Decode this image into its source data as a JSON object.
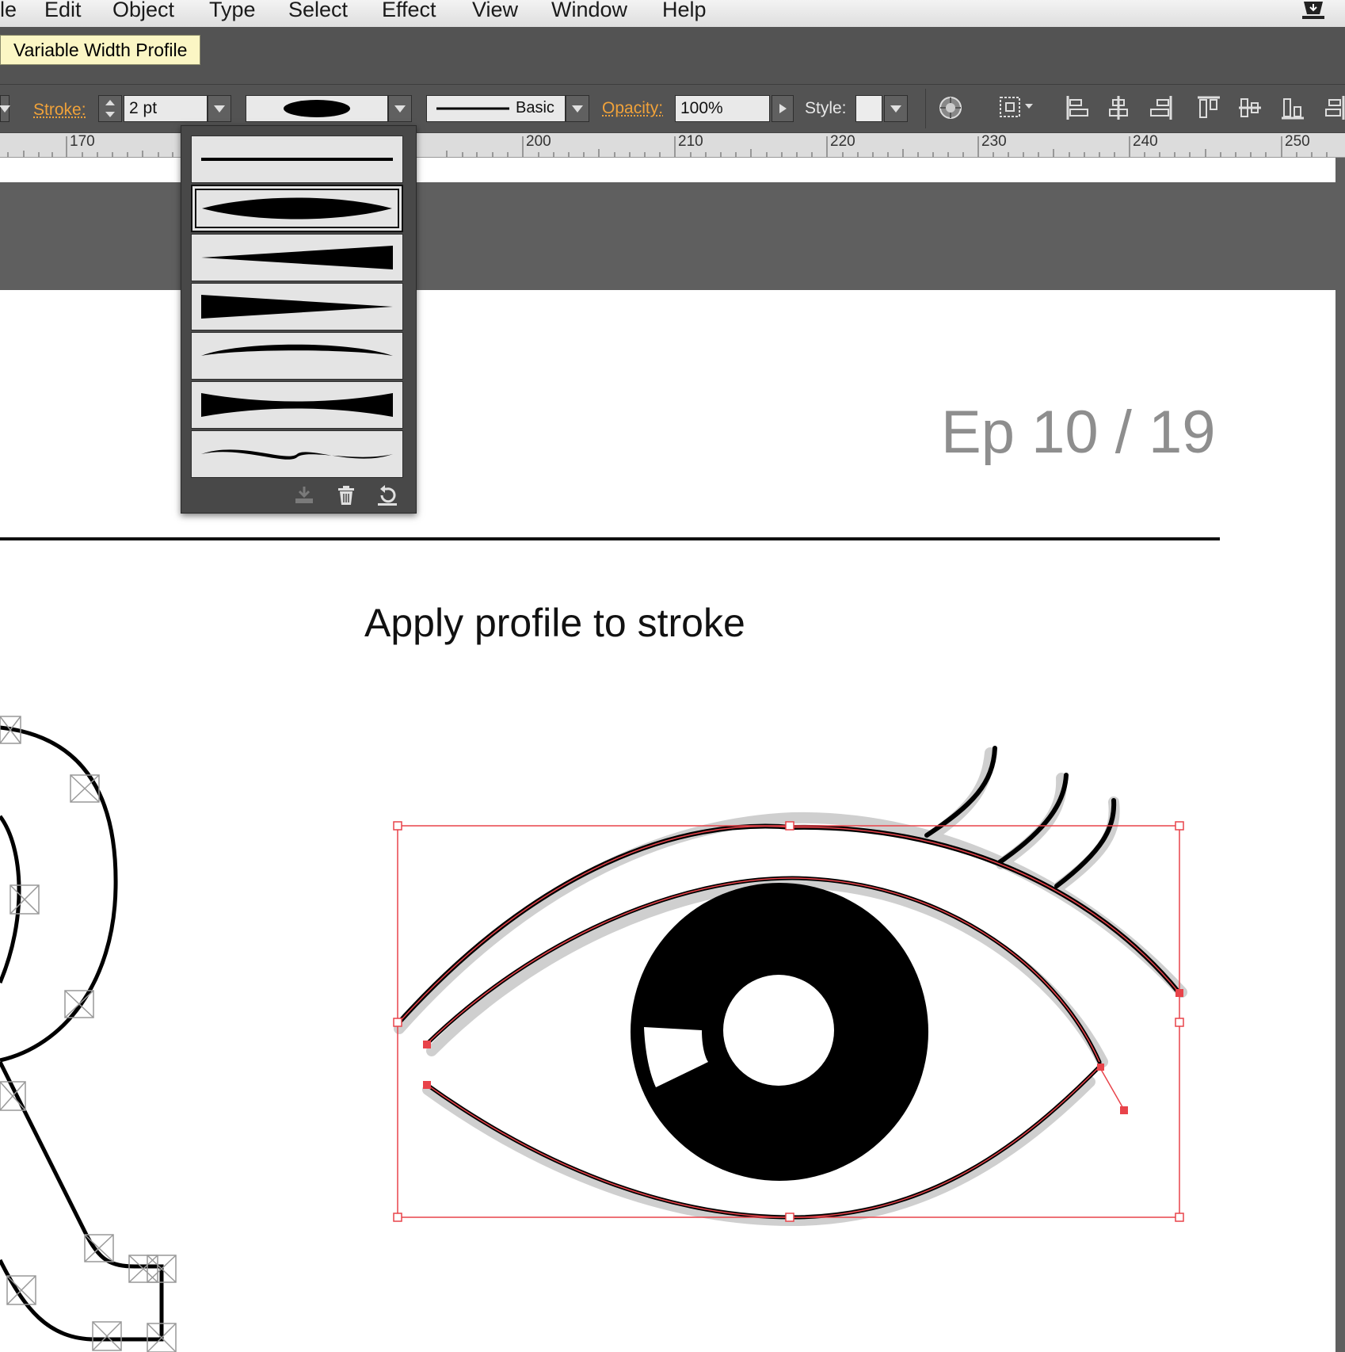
{
  "menubar": {
    "items": [
      "le",
      "Edit",
      "Object",
      "Type",
      "Select",
      "Effect",
      "View",
      "Window",
      "Help"
    ]
  },
  "tooltip": "Variable Width Profile",
  "control_bar": {
    "stroke_label": "Stroke:",
    "stroke_value": "2 pt",
    "brush_label": "Basic",
    "opacity_label": "Opacity:",
    "opacity_value": "100%",
    "style_label": "Style:"
  },
  "ruler": {
    "ticks": [
      "170",
      "200",
      "210",
      "220",
      "230",
      "240",
      "250"
    ]
  },
  "artboard": {
    "heading": "Ep 10 / 19",
    "subtitle": "Apply profile to stroke"
  },
  "profile_popup": {
    "profile_count": 7,
    "selected_index": 1,
    "buttons": [
      "save-profile-icon",
      "delete-profile-icon",
      "reset-profiles-icon"
    ]
  },
  "colors": {
    "accent_label": "#f0a23a",
    "selection": "#e8434a",
    "tooltip_bg": "#fbf6c4"
  }
}
